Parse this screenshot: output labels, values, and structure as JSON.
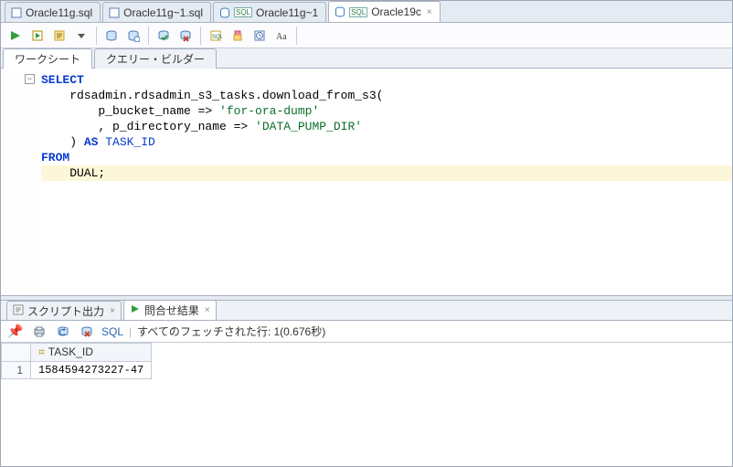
{
  "topTabs": {
    "t0": "Oracle11g.sql",
    "t1": "Oracle11g~1.sql",
    "t2": "Oracle11g~1",
    "t3": "Oracle19c"
  },
  "subtabs": {
    "worksheet": "ワークシート",
    "queryBuilder": "クエリー・ビルダー"
  },
  "sql": {
    "line1_kw": "SELECT",
    "line2": "    rdsadmin.rdsadmin_s3_tasks.download_from_s3(",
    "line3_prefix": "        p_bucket_name => ",
    "line3_str": "'for-ora-dump'",
    "line4_prefix": "        , p_directory_name => ",
    "line4_str": "'DATA_PUMP_DIR'",
    "line5a": "    ) ",
    "line5_as": "AS",
    "line5_id": " TASK_ID",
    "line6_from": "FROM",
    "line7": "    DUAL;"
  },
  "resultTabs": {
    "scriptOutput": "スクリプト出力",
    "queryResult": "問合せ結果"
  },
  "resultToolbar": {
    "sqlLabel": "SQL",
    "status": "すべてのフェッチされた行: 1(0.676秒)"
  },
  "grid": {
    "col1": "TASK_ID",
    "rows": [
      {
        "n": "1",
        "task_id": "1584594273227-47"
      }
    ]
  }
}
